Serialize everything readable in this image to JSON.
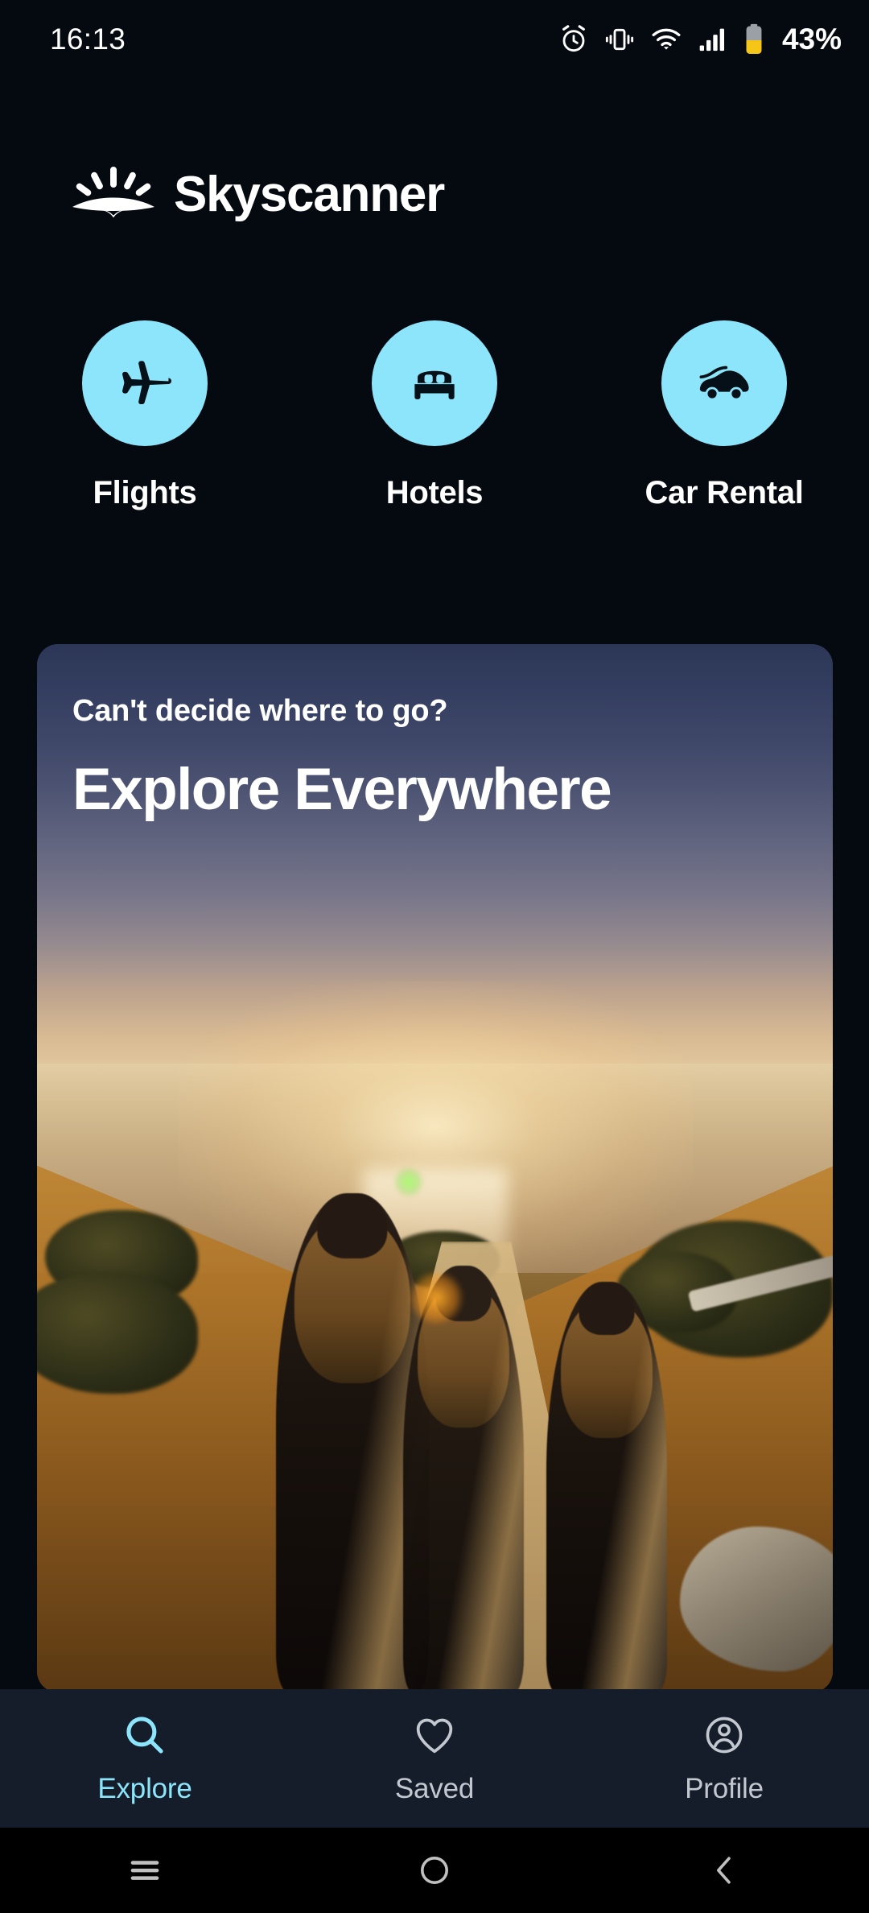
{
  "status_bar": {
    "time": "16:13",
    "battery_percent": "43%",
    "icons": [
      "alarm-icon",
      "vibrate-icon",
      "wifi-icon",
      "cellular-signal-icon",
      "battery-icon"
    ],
    "battery_fill_color": "#f5c518"
  },
  "brand": {
    "name": "Skyscanner",
    "logo_icon": "skyscanner-sunrise-logo"
  },
  "categories": [
    {
      "label": "Flights",
      "icon": "airplane-icon"
    },
    {
      "label": "Hotels",
      "icon": "bed-icon"
    },
    {
      "label": "Car Rental",
      "icon": "car-icon"
    }
  ],
  "explore_card": {
    "kicker": "Can't decide where to go?",
    "title": "Explore Everywhere",
    "image_alt": "Three people walking along a coastal trail at sunset"
  },
  "bottom_nav": [
    {
      "label": "Explore",
      "icon": "search-icon",
      "active": true
    },
    {
      "label": "Saved",
      "icon": "heart-icon",
      "active": false
    },
    {
      "label": "Profile",
      "icon": "person-icon",
      "active": false
    }
  ],
  "system_nav": [
    {
      "name": "recents-button",
      "icon": "hamburger-icon"
    },
    {
      "name": "home-button",
      "icon": "circle-icon"
    },
    {
      "name": "back-button",
      "icon": "chevron-left-icon"
    }
  ],
  "colors": {
    "page_background": "#050910",
    "accent": "#8ce5fb",
    "nav_background": "#151d2a",
    "text_primary": "#ffffff",
    "text_muted": "#c3c8d0"
  }
}
